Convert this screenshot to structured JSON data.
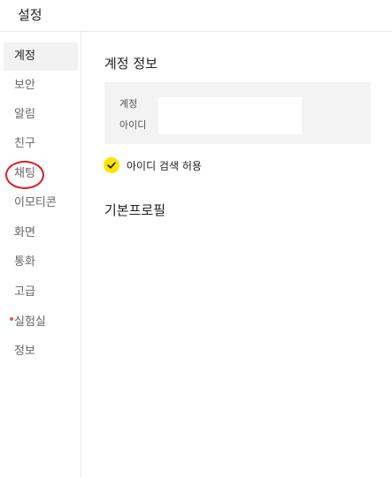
{
  "window": {
    "title": "설정"
  },
  "sidebar": {
    "items": [
      {
        "label": "계정",
        "active": true
      },
      {
        "label": "보안"
      },
      {
        "label": "알림"
      },
      {
        "label": "친구"
      },
      {
        "label": "채팅",
        "circled": true
      },
      {
        "label": "이모티콘"
      },
      {
        "label": "화면"
      },
      {
        "label": "통화"
      },
      {
        "label": "고급"
      },
      {
        "label": "실험실",
        "new_dot": true
      },
      {
        "label": "정보"
      }
    ]
  },
  "main": {
    "section_title": "계정 정보",
    "account": {
      "label_line1": "계정",
      "label_line2": "아이디",
      "value": ""
    },
    "id_search": {
      "label": "아이디 검색 허용",
      "checked": true
    },
    "profile_title": "기본프로필"
  },
  "colors": {
    "accent_yellow": "#fee500",
    "annotation_red": "#d61f26",
    "new_dot": "#f25a3c"
  },
  "icons": {
    "check": "check-icon"
  }
}
